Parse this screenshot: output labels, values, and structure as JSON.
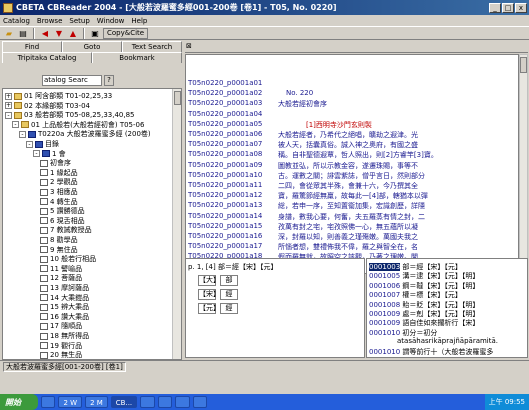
{
  "window": {
    "title": "CBETA CBReader 2004 - [大般若波羅蜜多經001-200卷 [卷1] - T05, No. 0220]",
    "controls": {
      "minimize": "_",
      "maximize": "□",
      "close": "x"
    }
  },
  "menu": {
    "items": [
      {
        "label": "Catalog"
      },
      {
        "label": "Browse"
      },
      {
        "label": "Setup"
      },
      {
        "label": "Window"
      },
      {
        "label": "Help"
      }
    ]
  },
  "toolbar": {
    "copy_cite_label": "Copy&Cite"
  },
  "left_panel": {
    "tabs_row1": [
      "Find",
      "Goto",
      "Text Search"
    ],
    "tabs_row2": [
      "Tripitaka Catalog",
      "Bookmark"
    ],
    "search_value": "atalog Searc",
    "help_button": "?",
    "tree": [
      {
        "exp": "+",
        "icon": "folder",
        "label": "01 阿含部類 T01-02,25,33",
        "depth": 0
      },
      {
        "exp": "+",
        "icon": "folder",
        "label": "02 本緣部類 T03-04",
        "depth": 0
      },
      {
        "exp": "-",
        "icon": "folder",
        "label": "03 般若部類 T05-08,25,33,40,85",
        "depth": 0
      },
      {
        "exp": "-",
        "icon": "folder",
        "label": "01 上品般若(大般若經初會) T05-06",
        "depth": 1
      },
      {
        "exp": "-",
        "icon": "book",
        "label": "T0220a 大般若波羅蜜多經 (200卷)",
        "depth": 2
      },
      {
        "exp": "-",
        "icon": "book",
        "label": "目錄",
        "depth": 3
      },
      {
        "exp": "-",
        "icon": "book",
        "label": "1 會",
        "depth": 4
      },
      {
        "exp": "",
        "icon": "page",
        "label": "初會序",
        "depth": 5
      },
      {
        "exp": "",
        "icon": "page",
        "label": "1 緣起品",
        "depth": 5
      },
      {
        "exp": "",
        "icon": "page",
        "label": "2 學觀品",
        "depth": 5
      },
      {
        "exp": "",
        "icon": "page",
        "label": "3 相應品",
        "depth": 5
      },
      {
        "exp": "",
        "icon": "page",
        "label": "4 轉生品",
        "depth": 5
      },
      {
        "exp": "",
        "icon": "page",
        "label": "5 讚勝德品",
        "depth": 5
      },
      {
        "exp": "",
        "icon": "page",
        "label": "6 現舌相品",
        "depth": 5
      },
      {
        "exp": "",
        "icon": "page",
        "label": "7 教誡教授品",
        "depth": 5
      },
      {
        "exp": "",
        "icon": "page",
        "label": "8 勸學品",
        "depth": 5
      },
      {
        "exp": "",
        "icon": "page",
        "label": "9 無住品",
        "depth": 5
      },
      {
        "exp": "",
        "icon": "page",
        "label": "10 般若行相品",
        "depth": 5
      },
      {
        "exp": "",
        "icon": "page",
        "label": "11 譬喻品",
        "depth": 5
      },
      {
        "exp": "",
        "icon": "page",
        "label": "12 菩薩品",
        "depth": 5
      },
      {
        "exp": "",
        "icon": "page",
        "label": "13 摩訶薩品",
        "depth": 5
      },
      {
        "exp": "",
        "icon": "page",
        "label": "14 大乘鎧品",
        "depth": 5
      },
      {
        "exp": "",
        "icon": "page",
        "label": "15 辨大乘品",
        "depth": 5
      },
      {
        "exp": "",
        "icon": "page",
        "label": "16 讚大乘品",
        "depth": 5
      },
      {
        "exp": "",
        "icon": "page",
        "label": "17 隨順品",
        "depth": 5
      },
      {
        "exp": "",
        "icon": "page",
        "label": "18 無所得品",
        "depth": 5
      },
      {
        "exp": "",
        "icon": "page",
        "label": "19 觀行品",
        "depth": 5
      },
      {
        "exp": "",
        "icon": "page",
        "label": "20 無生品",
        "depth": 5
      }
    ]
  },
  "text_pane": {
    "lines": [
      {
        "ref": "T05n0220_p0001a01",
        "text": "",
        "red": false
      },
      {
        "ref": "T05n0220_p0001a02",
        "text": "No. 220",
        "red": false
      },
      {
        "ref": "T05n0220_p0001a03",
        "text": "大般若經初會序",
        "red": false
      },
      {
        "ref": "T05n0220_p0001a04",
        "text": "",
        "red": false
      },
      {
        "ref": "T05n0220_p0001a05",
        "text": "[1]西明寺沙門玄則製",
        "red": true
      },
      {
        "ref": "T05n0220_p0001a06",
        "text": "大般若經者，乃希代之絕唱，曠劫之遐津。光",
        "red": false
      },
      {
        "ref": "T05n0220_p0001a07",
        "text": "被人天，括囊真俗。誠入神之奧府，有國之盛",
        "red": false
      },
      {
        "ref": "T05n0220_p0001a08",
        "text": "稱。自非聖德遐覃，哲人照出，則[2]方睿竿[3]寶。",
        "red": false
      },
      {
        "ref": "T05n0220_p0001a09",
        "text": "圖教並弘，所以示教金容，遂遷珠賜，事等不",
        "red": false
      },
      {
        "ref": "T05n0220_p0001a10",
        "text": "古。運數之關；誹雲紫誌，僧乎言日，然則部分",
        "red": false
      },
      {
        "ref": "T05n0220_p0001a11",
        "text": "二四，會從眾其半殊，會兼十六，今乃撰其全",
        "red": false
      },
      {
        "ref": "T05n0220_p0001a12",
        "text": "寶，羅驚節經無羸，故每此一[4]部，轄猶本以彈",
        "red": false
      },
      {
        "ref": "T05n0220_p0001a13",
        "text": "総，若申一序，至知置衞加集，宏識創歷，詳隱",
        "red": false
      },
      {
        "ref": "T05n0220_p0001a14",
        "text": "身譜，數我心要，何奮，夫五羅蒸有情之封，二",
        "red": false
      },
      {
        "ref": "T05n0220_p0001a15",
        "text": "孜萬有封之宅，宅孜照佛一心，無五蘊所以凝",
        "red": false
      },
      {
        "ref": "T05n0220_p0001a16",
        "text": "深，封羅以知，則善義之瑾殤嫩。萬國夫我之",
        "red": false
      },
      {
        "ref": "T05n0220_p0001a17",
        "text": "所惱者想，雙禮佈我不偉，羅之與智全在，名",
        "red": false
      },
      {
        "ref": "T05n0220_p0001a18",
        "text": "假而羅無就，故照空之該觀，乃著之理嫩。闡",
        "red": false
      },
      {
        "ref": "T05n0220_p0001a19",
        "text": "粉假於非動，畫義遠於不生，齊谷響於音名",
        "red": false
      }
    ]
  },
  "note_pane": {
    "header": "p. 1, [4] 部＝經【宋】【元】",
    "boxes": [
      "【大】",
      "部",
      "【宋】",
      "經",
      "【元】",
      "經"
    ]
  },
  "variant_pane": {
    "rows": [
      {
        "id": "0001003",
        "text": "部＝經【宋】【元】",
        "sel": true
      },
      {
        "id": "0001005",
        "text": "溝＝逮【宋】【元】【明】",
        "sel": false
      },
      {
        "id": "0001006",
        "text": "鋼＝韃【宋】【元】【明】",
        "sel": false
      },
      {
        "id": "0001007",
        "text": "權＝標【宋】【元】",
        "sel": false
      },
      {
        "id": "0001008",
        "text": "貽＝貶【宋】【元】【明】",
        "sel": false
      },
      {
        "id": "0001009",
        "text": "處＝剋【宋】【元】【明】",
        "sel": false
      },
      {
        "id": "0001009",
        "text": "語自佳如來擱析行【宋】",
        "sel": false
      },
      {
        "id": "0001010",
        "text": "初分＝初分",
        "sel": false
      },
      {
        "id": "",
        "text": "atasāhasrikāprajñāpāramitā.",
        "sel": false
      },
      {
        "id": "0001010",
        "text": "謂等前行十（大般若波羅蜜多",
        "sel": false
      }
    ]
  },
  "status": {
    "text": "大般若波羅蜜多經[001-200卷] [卷1]"
  },
  "taskbar": {
    "start": "開始",
    "tasks": [
      "",
      "2 W",
      "2 M",
      "CB...",
      "",
      "",
      "",
      ""
    ],
    "clock": "上午 09:55"
  }
}
